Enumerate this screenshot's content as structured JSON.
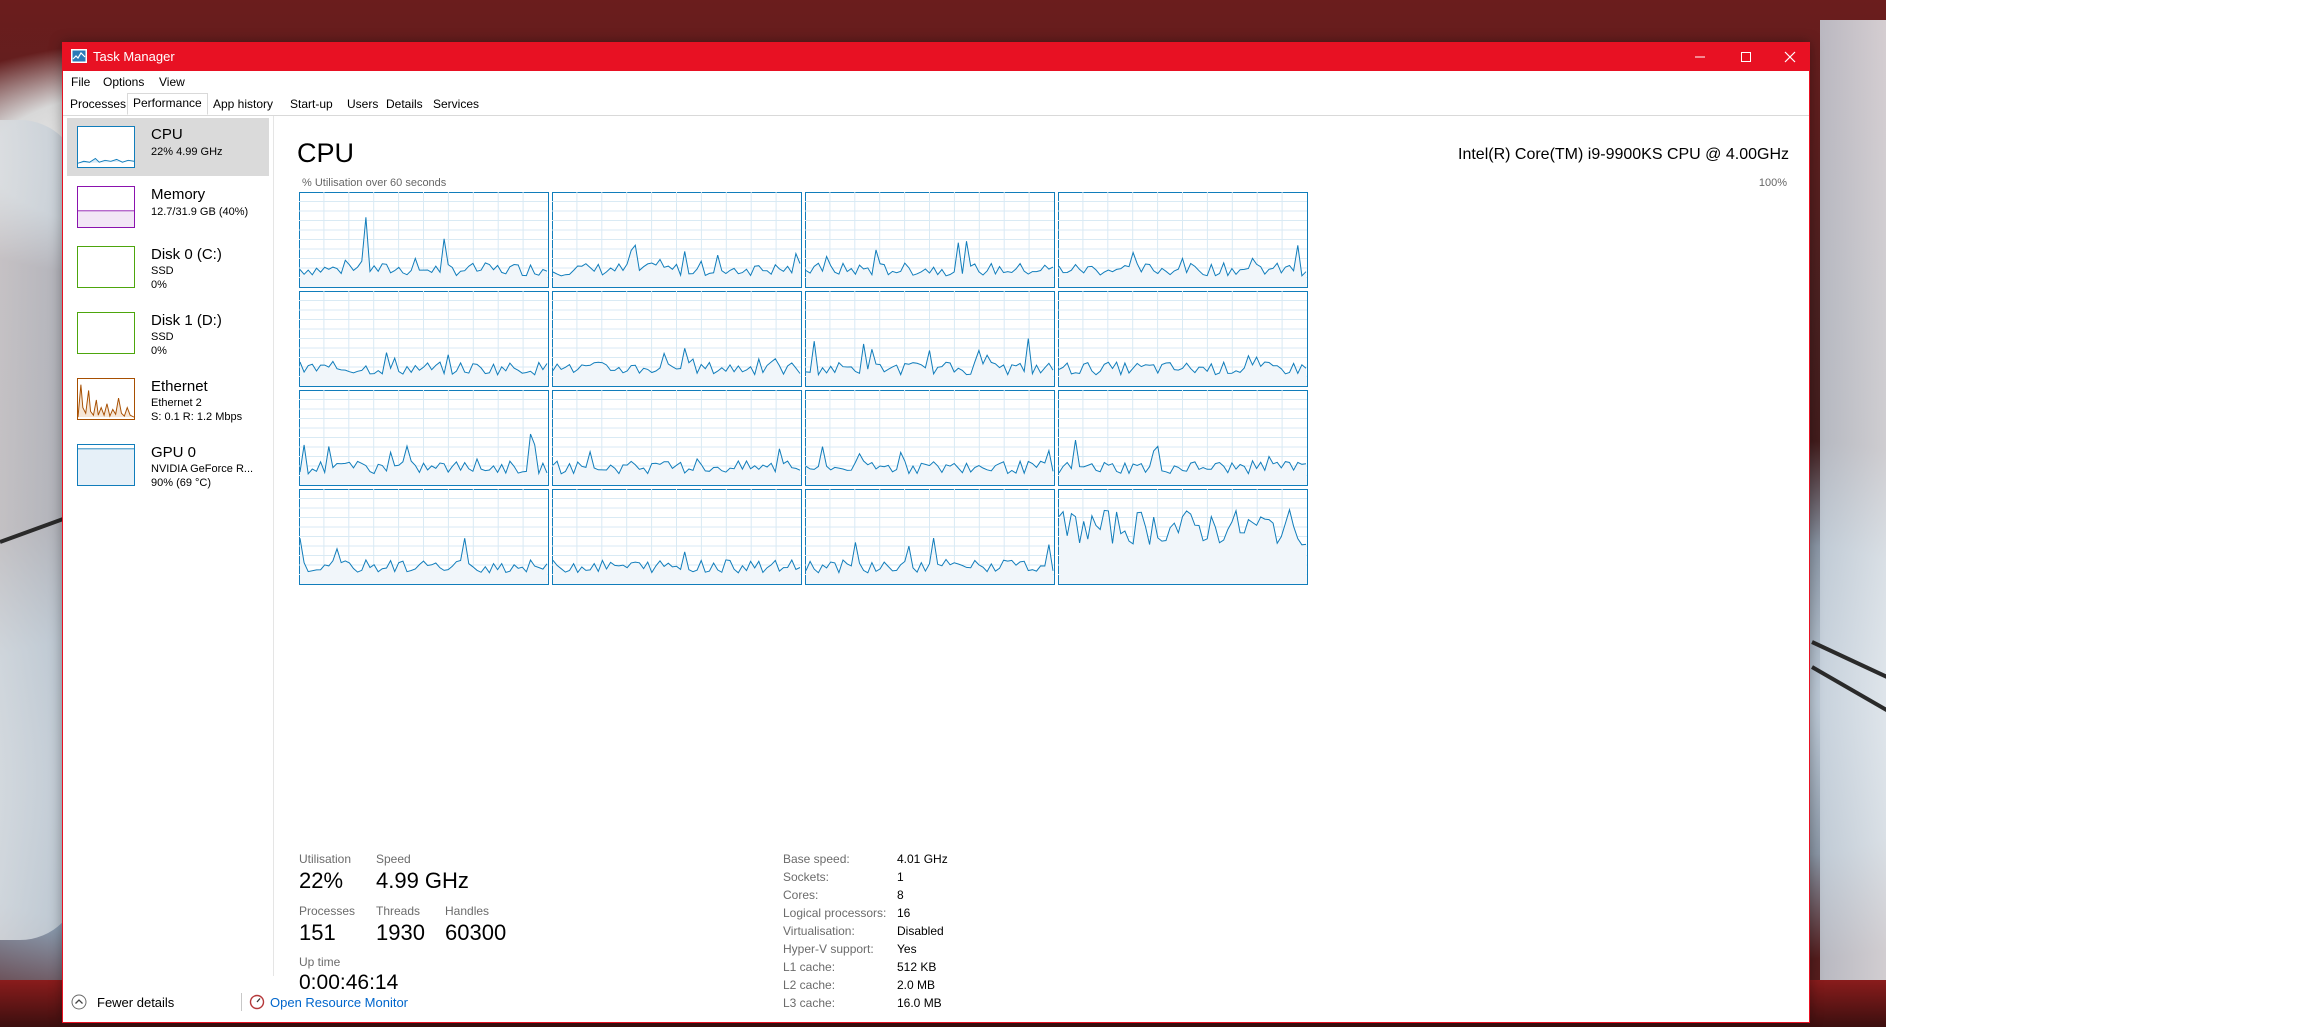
{
  "window": {
    "title": "Task Manager",
    "accent_color": "#e81123"
  },
  "menu": [
    "File",
    "Options",
    "View"
  ],
  "tabs": [
    {
      "label": "Processes",
      "active": false
    },
    {
      "label": "Performance",
      "active": true
    },
    {
      "label": "App history",
      "active": false
    },
    {
      "label": "Start-up",
      "active": false
    },
    {
      "label": "Users",
      "active": false
    },
    {
      "label": "Details",
      "active": false
    },
    {
      "label": "Services",
      "active": false
    }
  ],
  "sidebar": {
    "items": [
      {
        "title": "CPU",
        "line1": "22% 4.99 GHz",
        "line2": "",
        "color": "#117dbb",
        "selected": true
      },
      {
        "title": "Memory",
        "line1": "12.7/31.9 GB (40%)",
        "line2": "",
        "color": "#8b12ae",
        "selected": false
      },
      {
        "title": "Disk 0 (C:)",
        "line1": "SSD",
        "line2": "0%",
        "color": "#4da60c",
        "selected": false
      },
      {
        "title": "Disk 1 (D:)",
        "line1": "SSD",
        "line2": "0%",
        "color": "#4da60c",
        "selected": false
      },
      {
        "title": "Ethernet",
        "line1": "Ethernet 2",
        "line2": "S: 0.1  R: 1.2 Mbps",
        "color": "#a74f01",
        "selected": false
      },
      {
        "title": "GPU 0",
        "line1": "NVIDIA GeForce R...",
        "line2": "90% (69 °C)",
        "color": "#117dbb",
        "selected": false
      }
    ]
  },
  "cpu": {
    "heading": "CPU",
    "model": "Intel(R) Core(TM) i9-9900KS CPU @ 4.00GHz",
    "graph_label": "% Utilisation over 60 seconds",
    "graph_max": "100%",
    "graph_color": "#117dbb",
    "logical_processor_graphs": 16,
    "stats": {
      "utilisation_label": "Utilisation",
      "utilisation": "22%",
      "speed_label": "Speed",
      "speed": "4.99 GHz",
      "processes_label": "Processes",
      "processes": "151",
      "threads_label": "Threads",
      "threads": "1930",
      "handles_label": "Handles",
      "handles": "60300",
      "uptime_label": "Up time",
      "uptime": "0:00:46:14"
    },
    "properties": [
      {
        "label": "Base speed:",
        "value": "4.01 GHz"
      },
      {
        "label": "Sockets:",
        "value": "1"
      },
      {
        "label": "Cores:",
        "value": "8"
      },
      {
        "label": "Logical processors:",
        "value": "16"
      },
      {
        "label": "Virtualisation:",
        "value": "Disabled"
      },
      {
        "label": "Hyper-V support:",
        "value": "Yes"
      },
      {
        "label": "L1 cache:",
        "value": "512 KB"
      },
      {
        "label": "L2 cache:",
        "value": "2.0 MB"
      },
      {
        "label": "L3 cache:",
        "value": "16.0 MB"
      }
    ]
  },
  "footer": {
    "fewer_details": "Fewer details",
    "resource_monitor": "Open Resource Monitor"
  }
}
